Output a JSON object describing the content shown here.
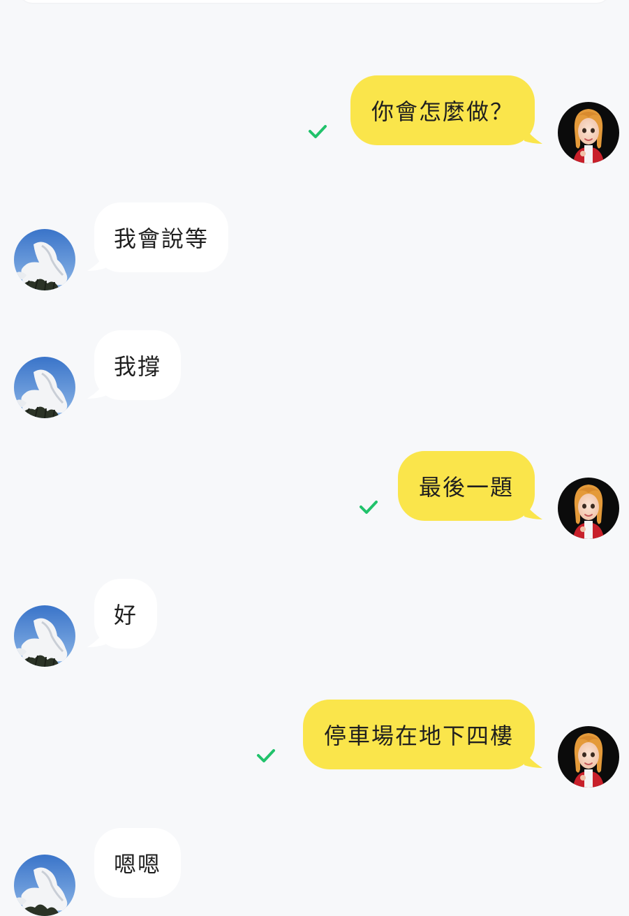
{
  "messages": [
    {
      "from": "me",
      "text": "你會怎麼做？",
      "status": "read-check"
    },
    {
      "from": "other",
      "text": "我會說等"
    },
    {
      "from": "other",
      "text": "我撐"
    },
    {
      "from": "me",
      "text": "最後一題",
      "status": "read-check"
    },
    {
      "from": "other",
      "text": "好"
    },
    {
      "from": "me",
      "text": "停車場在地下四樓",
      "status": "read-check"
    },
    {
      "from": "other",
      "text": "嗯嗯"
    }
  ],
  "colors": {
    "background": "#f7f8fa",
    "sent_bubble": "#fae54b",
    "received_bubble": "#ffffff",
    "check": "#21c26b",
    "text": "#1f1f1f"
  },
  "icons": {
    "sent_avatar": "cartoon-girl-avatar",
    "received_avatar": "sky-cloud-avatar",
    "status": "check-icon"
  }
}
